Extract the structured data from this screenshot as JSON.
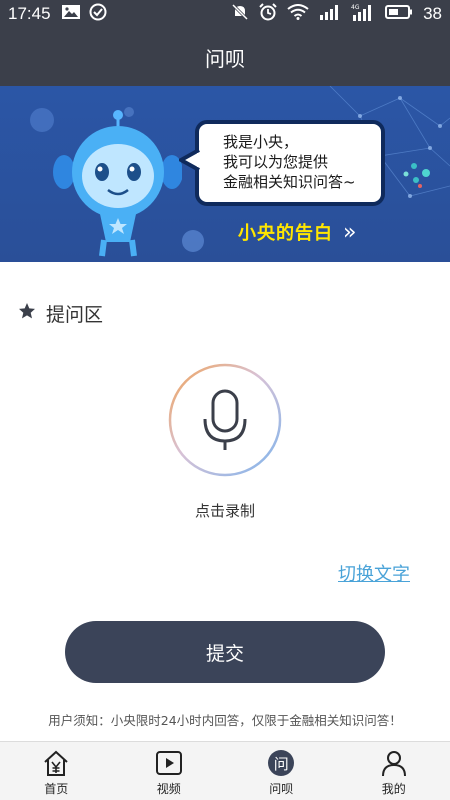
{
  "status_bar": {
    "time": "17:45",
    "battery": "38",
    "network_label": "4G",
    "icons": [
      "image-icon",
      "check-circle-icon",
      "mute-icon",
      "alarm-icon",
      "wifi-icon",
      "signal-icon",
      "signal-4g-icon",
      "battery-icon"
    ]
  },
  "titlebar": {
    "title": "问呗"
  },
  "banner": {
    "bubble_lines": [
      "我是小央，",
      "我可以为您提供",
      "金融相关知识问答~"
    ],
    "slogan": "小央的告白",
    "slogan_arrow": "»",
    "colors": {
      "background": "#2b56a6",
      "slogan": "#ffe600"
    }
  },
  "question_area": {
    "heading": "提问区",
    "record_label": "点击录制",
    "switch_link": "切换文字",
    "submit_label": "提交",
    "notice": "用户须知：小央限时24小时内回答，仅限于金融相关知识问答！"
  },
  "bottom_nav": {
    "items": [
      {
        "label": "首页",
        "icon": "home-yen-icon",
        "active": false
      },
      {
        "label": "视频",
        "icon": "video-play-icon",
        "active": false
      },
      {
        "label": "问呗",
        "icon_text": "问",
        "active": true
      },
      {
        "label": "我的",
        "icon": "user-icon",
        "active": false
      }
    ]
  },
  "colors": {
    "header": "#3b3f4a",
    "link": "#4aa3d8",
    "button": "#3b4459"
  }
}
